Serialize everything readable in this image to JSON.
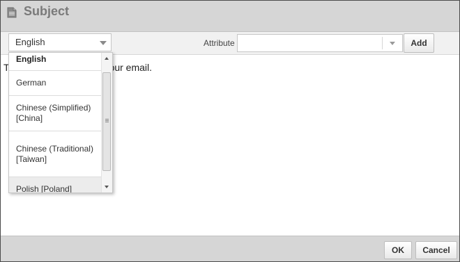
{
  "dialog": {
    "title": "Subject",
    "icon": "document-icon"
  },
  "toolbar": {
    "language_selected": "English",
    "attribute_label": "Attribute",
    "attribute_value": "",
    "add_label": "Add"
  },
  "content": {
    "text": "T",
    "text_tail": "our email."
  },
  "language_dropdown": {
    "items": [
      "English",
      "German",
      "Chinese (Simplified) [China]",
      "Chinese (Traditional) [Taiwan]",
      "Polish [Poland]"
    ],
    "selected_index": 0,
    "hovered_index": 4
  },
  "footer": {
    "ok_label": "OK",
    "cancel_label": "Cancel"
  }
}
